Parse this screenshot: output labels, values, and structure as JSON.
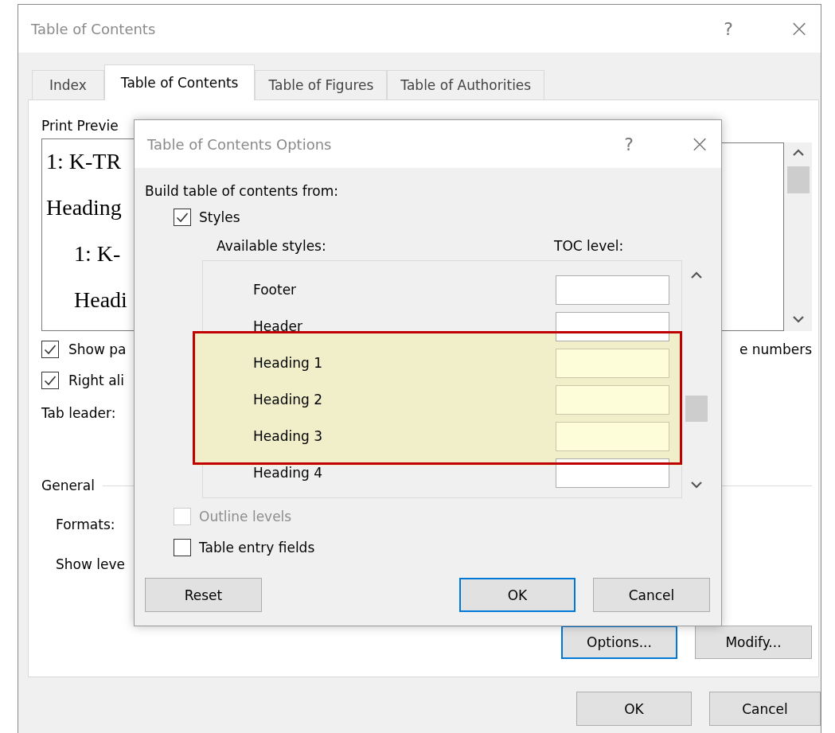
{
  "window": {
    "title": "Table of Contents",
    "help": "?",
    "close": "×"
  },
  "tabs": [
    {
      "label": "Index",
      "selected": false
    },
    {
      "label": "Table of Contents",
      "selected": true
    },
    {
      "label": "Table of Figures",
      "selected": false
    },
    {
      "label": "Table of Authorities",
      "selected": false
    }
  ],
  "print_preview": {
    "label": "Print Previe",
    "lines": [
      {
        "text": "1: K-TR",
        "kind": "top"
      },
      {
        "text": "Heading",
        "kind": "top"
      },
      {
        "text": "1: K-",
        "kind": "indented"
      },
      {
        "text": "Headi",
        "kind": "indented"
      }
    ]
  },
  "print_options": [
    {
      "label": "Show pa",
      "checked": true
    },
    {
      "label": "Right ali",
      "checked": true
    }
  ],
  "tab_leader_label": "Tab leader:",
  "web_preview": {
    "option_label": "e numbers"
  },
  "general": {
    "title": "General",
    "formats_label": "Formats:",
    "show_levels_label": "Show leve"
  },
  "panel_buttons": [
    {
      "label": "Options...",
      "focused": true
    },
    {
      "label": "Modify...",
      "focused": false
    }
  ],
  "buttons": [
    {
      "label": "OK",
      "focused": false
    },
    {
      "label": "Cancel",
      "focused": false
    }
  ],
  "options_dialog": {
    "title": "Table of Contents Options",
    "help": "?",
    "close": "×",
    "build_label": "Build table of contents from:",
    "styles_option": {
      "label": "Styles",
      "checked": true,
      "disabled": false
    },
    "available_styles_label": "Available styles:",
    "toc_level_label": "TOC level:",
    "styles": [
      {
        "name": "Footer",
        "highlighted": false
      },
      {
        "name": "Header",
        "highlighted": false
      },
      {
        "name": "Heading 1",
        "highlighted": true
      },
      {
        "name": "Heading 2",
        "highlighted": true
      },
      {
        "name": "Heading 3",
        "highlighted": true
      },
      {
        "name": "Heading 4",
        "highlighted": false
      }
    ],
    "other_options": [
      {
        "label": "Outline levels",
        "checked": false,
        "disabled": true
      },
      {
        "label": "Table entry fields",
        "checked": false,
        "disabled": false
      }
    ],
    "buttons": [
      {
        "label": "Reset",
        "focused": false
      },
      {
        "label": "OK",
        "focused": true
      },
      {
        "label": "Cancel",
        "focused": false
      }
    ]
  }
}
